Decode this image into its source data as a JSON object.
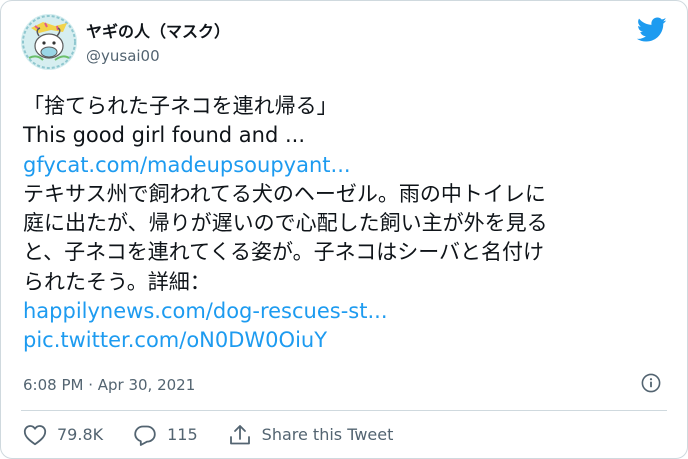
{
  "author": {
    "display_name": "ヤギの人（マスク）",
    "handle": "@yusai00"
  },
  "tweet": {
    "line1": "「捨てられた子ネコを連れ帰る」",
    "line2": "This good girl found and ...",
    "link1": "gfycat.com/madeupsoupyant...",
    "jp1": "テキサス州で飼われてる犬のヘーゼル。雨の中トイレに",
    "jp2": "庭に出たが、帰りが遅いので心配した飼い主が外を見る",
    "jp3": "と、子ネコを連れてくる姿が。子ネコはシーバと名付け",
    "jp4": "られたそう。詳細：",
    "link2": "happilynews.com/dog-rescues-st...",
    "link3": "pic.twitter.com/oN0DW0OiuY"
  },
  "meta": {
    "timestamp": "6:08 PM · Apr 30, 2021"
  },
  "actions": {
    "like_count": "79.8K",
    "reply_count": "115",
    "share_label": "Share this Tweet"
  },
  "icons": {
    "brand": "twitter-bird-icon",
    "info": "info-icon",
    "like": "heart-icon",
    "reply": "reply-icon",
    "share": "share-icon"
  },
  "colors": {
    "brand_blue": "#1d9bf0",
    "link": "#1d9bf0",
    "text": "#0f1419",
    "muted": "#536471",
    "border": "#cfd9de"
  }
}
